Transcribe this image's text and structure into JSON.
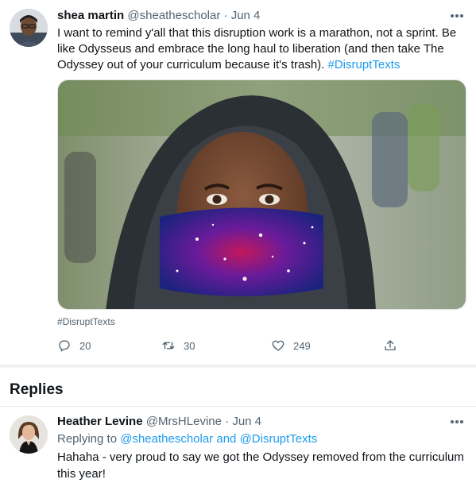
{
  "tweet": {
    "author_name": "shea martin",
    "author_handle": "@sheathescholar",
    "separator": "·",
    "date": "Jun 4",
    "text": "I want to remind y'all that this disruption work is a marathon, not a sprint. Be like Odysseus and embrace the long haul to liberation (and then take The Odyssey out of your curriculum because it's trash). ",
    "hashtag": "#DisruptTexts",
    "media_tag": "#DisruptTexts",
    "replies_count": "20",
    "retweets_count": "30",
    "likes_count": "249"
  },
  "replies_section": {
    "heading": "Replies"
  },
  "reply": {
    "author_name": "Heather Levine",
    "author_handle": "@MrsHLevine",
    "separator": "·",
    "date": "Jun 4",
    "replying_prefix": "Replying to",
    "mention_1": "@sheathescholar",
    "and_word": "and",
    "mention_2": "@DisruptTexts",
    "text": "Hahaha - very proud to say we got the Odyssey removed from the curriculum this year!"
  },
  "icons": {
    "reply": "reply-icon",
    "retweet": "retweet-icon",
    "like": "heart-icon",
    "share": "share-icon",
    "more": "more-icon"
  },
  "colors": {
    "link": "#1d9bf0",
    "secondary_text": "#536471",
    "primary_text": "#0f1419"
  }
}
